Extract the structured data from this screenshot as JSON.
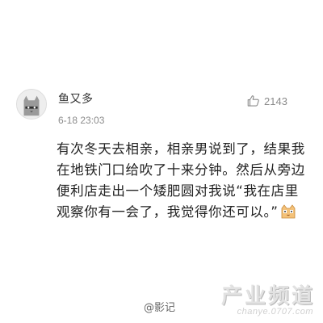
{
  "comment": {
    "username": "鱼又多",
    "timestamp": "6-18 23:03",
    "like_count": "2143",
    "text": "有次冬天去相亲，相亲男说到了，结果我\n在地铁门口给吹了十来分钟。然后从旁边\n便利店走出一个矮肥圆对我说“我在店里\n观察你有一会了，我觉得你还可以。”",
    "emoji": "cat-face-emoji"
  },
  "source": "@影记",
  "watermark": {
    "text": "产业频道",
    "url": "chanye.0707.com"
  },
  "icons": {
    "like": "thumbs-up-icon",
    "avatar": "cat-avatar"
  },
  "colors": {
    "text": "#222222",
    "muted": "#8c8c8c",
    "background": "#ffffff"
  }
}
